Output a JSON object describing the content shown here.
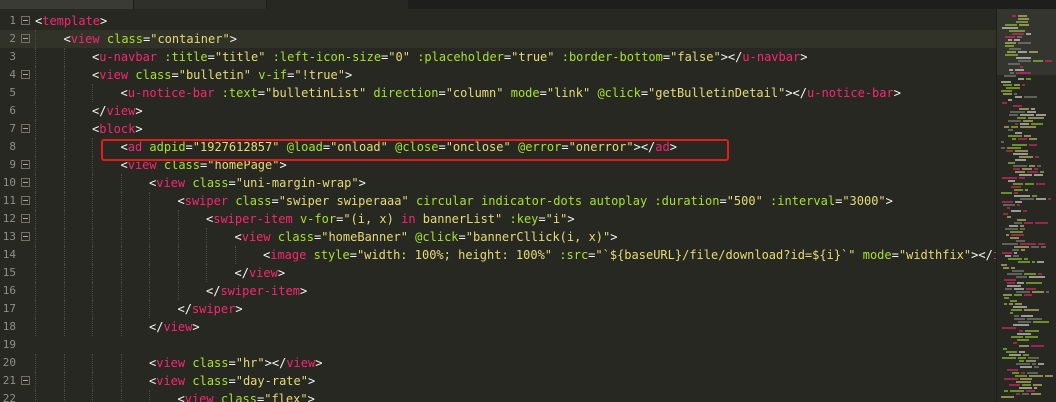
{
  "tabs": [
    "",
    "",
    ""
  ],
  "highlight_label": "ad adpid highlight",
  "lines": [
    {
      "n": "1",
      "fold": true,
      "guides": 0,
      "tokens": [
        [
          "p",
          "<"
        ],
        [
          "tg",
          "template"
        ],
        [
          "p",
          ">"
        ]
      ]
    },
    {
      "n": "2",
      "fold": true,
      "guides": 1,
      "active": true,
      "tokens": [
        [
          "p",
          "<"
        ],
        [
          "tg",
          "view"
        ],
        [
          "p",
          " "
        ],
        [
          "at",
          "class"
        ],
        [
          "p",
          "="
        ],
        [
          "st",
          "\"container\""
        ],
        [
          "p",
          ">"
        ]
      ]
    },
    {
      "n": "3",
      "guides": 2,
      "tokens": [
        [
          "p",
          "<"
        ],
        [
          "tg",
          "u-navbar"
        ],
        [
          "p",
          " "
        ],
        [
          "at",
          ":title"
        ],
        [
          "p",
          "="
        ],
        [
          "st",
          "\"title\""
        ],
        [
          "p",
          " "
        ],
        [
          "at",
          ":left-icon-size"
        ],
        [
          "p",
          "="
        ],
        [
          "st",
          "\"0\""
        ],
        [
          "p",
          " "
        ],
        [
          "at",
          ":placeholder"
        ],
        [
          "p",
          "="
        ],
        [
          "st",
          "\"true\""
        ],
        [
          "p",
          " "
        ],
        [
          "at",
          ":border-bottom"
        ],
        [
          "p",
          "="
        ],
        [
          "st",
          "\"false\""
        ],
        [
          "p",
          "></"
        ],
        [
          "tg",
          "u-navbar"
        ],
        [
          "p",
          ">"
        ]
      ]
    },
    {
      "n": "4",
      "fold": true,
      "guides": 2,
      "tokens": [
        [
          "p",
          "<"
        ],
        [
          "tg",
          "view"
        ],
        [
          "p",
          " "
        ],
        [
          "at",
          "class"
        ],
        [
          "p",
          "="
        ],
        [
          "st",
          "\"bulletin\""
        ],
        [
          "p",
          " "
        ],
        [
          "at",
          "v-if"
        ],
        [
          "p",
          "="
        ],
        [
          "st",
          "\"!true\""
        ],
        [
          "p",
          ">"
        ]
      ]
    },
    {
      "n": "5",
      "guides": 3,
      "tokens": [
        [
          "p",
          "<"
        ],
        [
          "tg",
          "u-notice-bar"
        ],
        [
          "p",
          " "
        ],
        [
          "at",
          ":text"
        ],
        [
          "p",
          "="
        ],
        [
          "st",
          "\"bulletinList\""
        ],
        [
          "p",
          " "
        ],
        [
          "at",
          "direction"
        ],
        [
          "p",
          "="
        ],
        [
          "st",
          "\"column\""
        ],
        [
          "p",
          " "
        ],
        [
          "at",
          "mode"
        ],
        [
          "p",
          "="
        ],
        [
          "st",
          "\"link\""
        ],
        [
          "p",
          " "
        ],
        [
          "at",
          "@click"
        ],
        [
          "p",
          "="
        ],
        [
          "st",
          "\"getBulletinDetail\""
        ],
        [
          "p",
          "></"
        ],
        [
          "tg",
          "u-notice-bar"
        ],
        [
          "p",
          ">"
        ]
      ]
    },
    {
      "n": "6",
      "guides": 2,
      "tokens": [
        [
          "p",
          "</"
        ],
        [
          "tg",
          "view"
        ],
        [
          "p",
          ">"
        ]
      ]
    },
    {
      "n": "7",
      "fold": true,
      "guides": 2,
      "tokens": [
        [
          "p",
          "<"
        ],
        [
          "tg",
          "block"
        ],
        [
          "p",
          ">"
        ]
      ]
    },
    {
      "n": "8",
      "guides": 3,
      "tokens": [
        [
          "p",
          "<"
        ],
        [
          "tg",
          "ad"
        ],
        [
          "p",
          " "
        ],
        [
          "at",
          "adpid"
        ],
        [
          "p",
          "="
        ],
        [
          "st",
          "\"1927612857\""
        ],
        [
          "p",
          " "
        ],
        [
          "at",
          "@load"
        ],
        [
          "p",
          "="
        ],
        [
          "st",
          "\"onload\""
        ],
        [
          "p",
          " "
        ],
        [
          "at",
          "@close"
        ],
        [
          "p",
          "="
        ],
        [
          "st",
          "\"onclose\""
        ],
        [
          "p",
          " "
        ],
        [
          "at",
          "@error"
        ],
        [
          "p",
          "="
        ],
        [
          "st",
          "\"onerror\""
        ],
        [
          "p",
          "></"
        ],
        [
          "tg",
          "ad"
        ],
        [
          "p",
          ">"
        ]
      ]
    },
    {
      "n": "9",
      "fold": true,
      "guides": 3,
      "tokens": [
        [
          "p",
          "<"
        ],
        [
          "tg",
          "view"
        ],
        [
          "p",
          " "
        ],
        [
          "at",
          "class"
        ],
        [
          "p",
          "="
        ],
        [
          "st",
          "\"homePage\""
        ],
        [
          "p",
          ">"
        ]
      ]
    },
    {
      "n": "10",
      "fold": true,
      "guides": 4,
      "tokens": [
        [
          "p",
          "<"
        ],
        [
          "tg",
          "view"
        ],
        [
          "p",
          " "
        ],
        [
          "at",
          "class"
        ],
        [
          "p",
          "="
        ],
        [
          "st",
          "\"uni-margin-wrap\""
        ],
        [
          "p",
          ">"
        ]
      ]
    },
    {
      "n": "11",
      "fold": true,
      "guides": 5,
      "tokens": [
        [
          "p",
          "<"
        ],
        [
          "tg",
          "swiper"
        ],
        [
          "p",
          " "
        ],
        [
          "at",
          "class"
        ],
        [
          "p",
          "="
        ],
        [
          "st",
          "\"swiper swiperaaa\""
        ],
        [
          "p",
          " "
        ],
        [
          "at",
          "circular"
        ],
        [
          "p",
          " "
        ],
        [
          "at",
          "indicator-dots"
        ],
        [
          "p",
          " "
        ],
        [
          "at",
          "autoplay"
        ],
        [
          "p",
          " "
        ],
        [
          "at",
          ":duration"
        ],
        [
          "p",
          "="
        ],
        [
          "st",
          "\"500\""
        ],
        [
          "p",
          " "
        ],
        [
          "at",
          ":interval"
        ],
        [
          "p",
          "="
        ],
        [
          "st",
          "\"3000\""
        ],
        [
          "p",
          ">"
        ]
      ]
    },
    {
      "n": "12",
      "fold": true,
      "guides": 6,
      "tokens": [
        [
          "p",
          "<"
        ],
        [
          "tg",
          "swiper-item"
        ],
        [
          "p",
          " "
        ],
        [
          "at",
          "v-for"
        ],
        [
          "p",
          "="
        ],
        [
          "st",
          "\"(i, x) "
        ],
        [
          "iv",
          "in"
        ],
        [
          "st",
          " bannerList\""
        ],
        [
          "p",
          " "
        ],
        [
          "at",
          ":key"
        ],
        [
          "p",
          "="
        ],
        [
          "st",
          "\"i\""
        ],
        [
          "p",
          ">"
        ]
      ]
    },
    {
      "n": "13",
      "fold": true,
      "guides": 7,
      "tokens": [
        [
          "p",
          "<"
        ],
        [
          "tg",
          "view"
        ],
        [
          "p",
          " "
        ],
        [
          "at",
          "class"
        ],
        [
          "p",
          "="
        ],
        [
          "st",
          "\"homeBanner\""
        ],
        [
          "p",
          " "
        ],
        [
          "at",
          "@click"
        ],
        [
          "p",
          "="
        ],
        [
          "st",
          "\"bannerCllick(i, x)\""
        ],
        [
          "p",
          ">"
        ]
      ]
    },
    {
      "n": "14",
      "guides": 8,
      "tokens": [
        [
          "p",
          "<"
        ],
        [
          "tg",
          "image"
        ],
        [
          "p",
          " "
        ],
        [
          "at",
          "style"
        ],
        [
          "p",
          "="
        ],
        [
          "st",
          "\"width: 100%; height: 100%\""
        ],
        [
          "p",
          " "
        ],
        [
          "at",
          ":src"
        ],
        [
          "p",
          "="
        ],
        [
          "st",
          "\"`${baseURL}/file/download?id=${i}`\""
        ],
        [
          "p",
          " "
        ],
        [
          "at",
          "mode"
        ],
        [
          "p",
          "="
        ],
        [
          "st",
          "\"widthfix\""
        ],
        [
          "p",
          "></"
        ],
        [
          "tg",
          "image"
        ]
      ]
    },
    {
      "n": "15",
      "guides": 7,
      "tokens": [
        [
          "p",
          "</"
        ],
        [
          "tg",
          "view"
        ],
        [
          "p",
          ">"
        ]
      ]
    },
    {
      "n": "16",
      "guides": 6,
      "tokens": [
        [
          "p",
          "</"
        ],
        [
          "tg",
          "swiper-item"
        ],
        [
          "p",
          ">"
        ]
      ]
    },
    {
      "n": "17",
      "guides": 5,
      "tokens": [
        [
          "p",
          "</"
        ],
        [
          "tg",
          "swiper"
        ],
        [
          "p",
          ">"
        ]
      ]
    },
    {
      "n": "18",
      "guides": 4,
      "tokens": [
        [
          "p",
          "</"
        ],
        [
          "tg",
          "view"
        ],
        [
          "p",
          ">"
        ]
      ]
    },
    {
      "n": "19",
      "guides": 0,
      "tokens": []
    },
    {
      "n": "20",
      "guides": 4,
      "tokens": [
        [
          "p",
          "<"
        ],
        [
          "tg",
          "view"
        ],
        [
          "p",
          " "
        ],
        [
          "at",
          "class"
        ],
        [
          "p",
          "="
        ],
        [
          "st",
          "\"hr\""
        ],
        [
          "p",
          "></"
        ],
        [
          "tg",
          "view"
        ],
        [
          "p",
          ">"
        ]
      ]
    },
    {
      "n": "21",
      "fold": true,
      "guides": 4,
      "tokens": [
        [
          "p",
          "<"
        ],
        [
          "tg",
          "view"
        ],
        [
          "p",
          " "
        ],
        [
          "at",
          "class"
        ],
        [
          "p",
          "="
        ],
        [
          "st",
          "\"day-rate\""
        ],
        [
          "p",
          ">"
        ]
      ]
    },
    {
      "n": "22",
      "guides": 5,
      "tokens": [
        [
          "p",
          "<"
        ],
        [
          "tg",
          "view"
        ],
        [
          "p",
          " "
        ],
        [
          "at",
          "class"
        ],
        [
          "p",
          "="
        ],
        [
          "st",
          "\"flex\""
        ],
        [
          "p",
          ">"
        ]
      ]
    }
  ]
}
